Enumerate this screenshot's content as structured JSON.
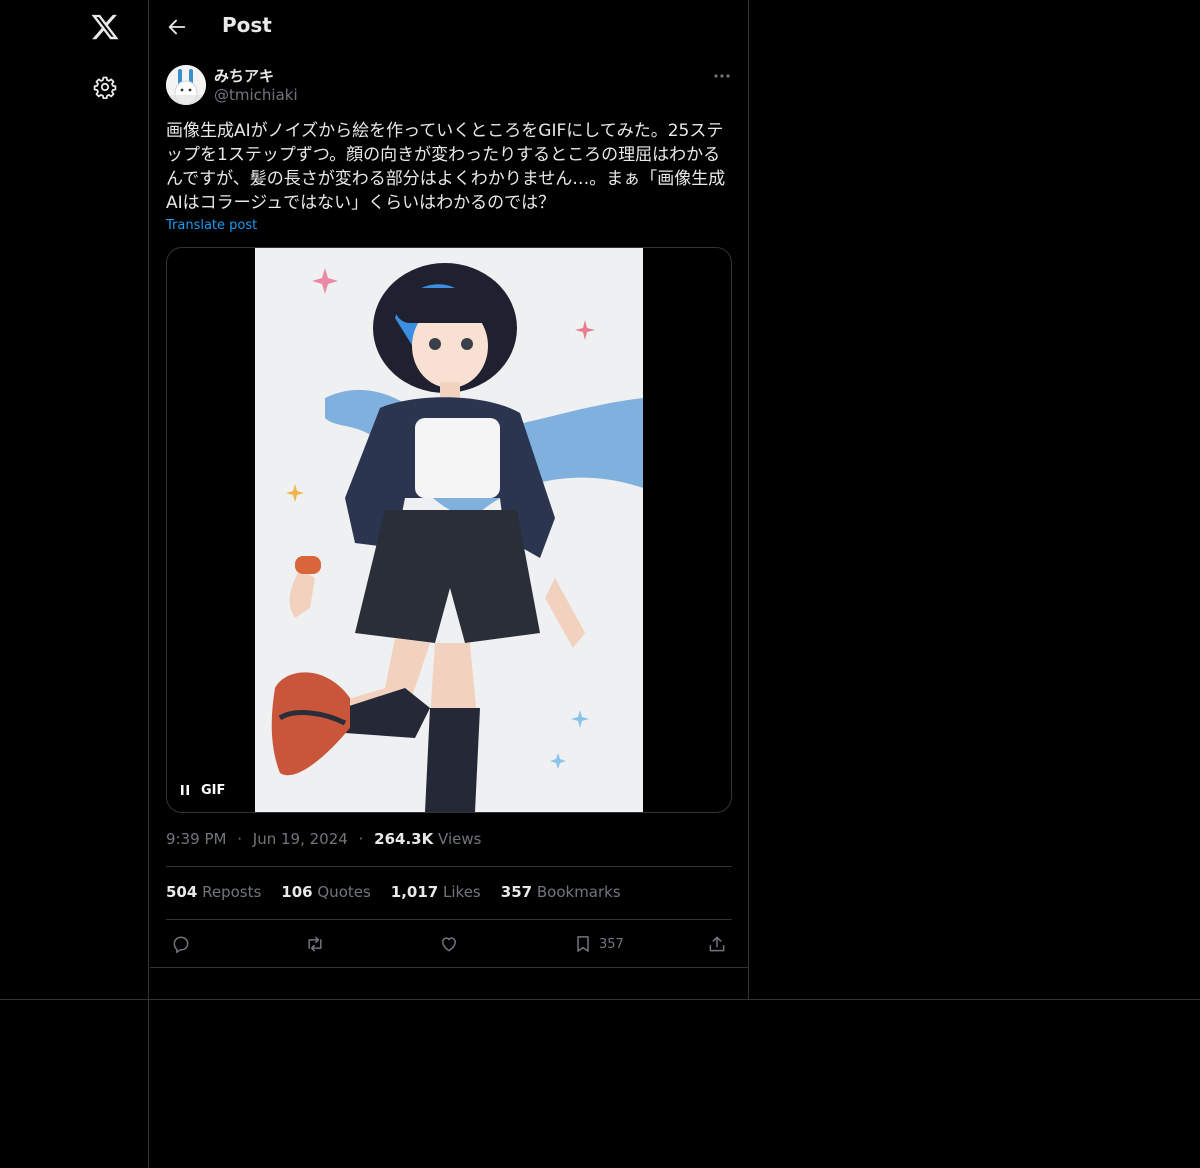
{
  "nav": {
    "logo_icon": "x-logo-icon",
    "settings_icon": "gear-icon"
  },
  "header": {
    "back_icon": "back-arrow-icon",
    "title": "Post"
  },
  "post": {
    "author": {
      "display_name": "みちアキ",
      "handle": "@tmichiaki"
    },
    "text": "画像生成AIがノイズから絵を作っていくところをGIFにしてみた。25ステップを1ステップずつ。顔の向きが変わったりするところの理屈はわかるんですが、髪の長さが変わる部分はよくわかりません…。まぁ「画像生成AIはコラージュではない」くらいはわかるのでは？",
    "translate_label": "Translate post",
    "media": {
      "badge": "GIF",
      "pause_icon": "pause-icon"
    },
    "time": "9:39 PM",
    "date": "Jun 19, 2024",
    "views_count": "264.3K",
    "views_label": "Views",
    "separator": "·"
  },
  "stats": {
    "reposts_count": "504",
    "reposts_label": "Reposts",
    "quotes_count": "106",
    "quotes_label": "Quotes",
    "likes_count": "1,017",
    "likes_label": "Likes",
    "bookmarks_count": "357",
    "bookmarks_label": "Bookmarks"
  },
  "actions": {
    "reply_icon": "reply-icon",
    "repost_icon": "repost-icon",
    "like_icon": "heart-icon",
    "bookmark_icon": "bookmark-icon",
    "bookmark_count": "357",
    "share_icon": "share-icon"
  },
  "colors": {
    "background": "#000000",
    "border": "#2f3336",
    "text_primary": "#e7e9ea",
    "text_secondary": "#71767b",
    "link": "#1d9bf0"
  }
}
